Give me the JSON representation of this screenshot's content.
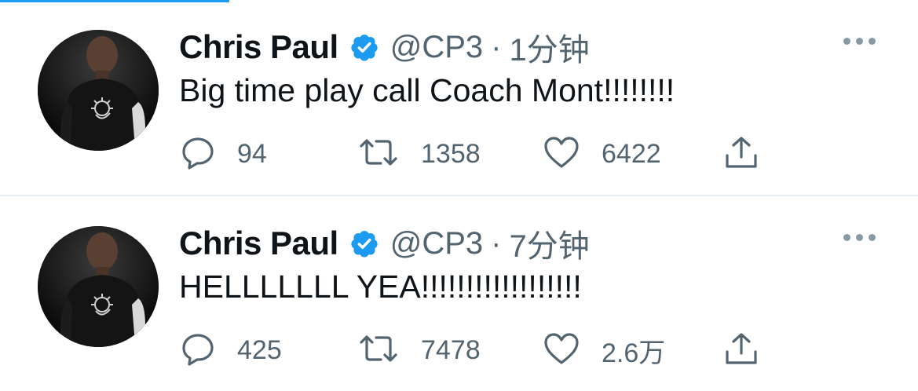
{
  "colors": {
    "accent": "#1d9bf0",
    "secondary_text": "#536471",
    "divider": "#e6ecf0",
    "primary_text": "#0f1419"
  },
  "tweets": [
    {
      "author_name": "Chris Paul",
      "handle": "@CP3",
      "separator": "·",
      "time": "1分钟",
      "text": "Big time play call Coach Mont!!!!!!!!",
      "replies": "94",
      "retweets": "1358",
      "likes": "6422"
    },
    {
      "author_name": "Chris Paul",
      "handle": "@CP3",
      "separator": "·",
      "time": "7分钟",
      "text": "HELLLLLLL YEA!!!!!!!!!!!!!!!!!!",
      "replies": "425",
      "retweets": "7478",
      "likes": "2.6万"
    }
  ],
  "icons": {
    "verified": "verified-badge-icon",
    "more": "more-dots-icon",
    "reply": "reply-bubble-icon",
    "retweet": "retweet-icon",
    "like": "heart-icon",
    "share": "share-upload-icon"
  }
}
